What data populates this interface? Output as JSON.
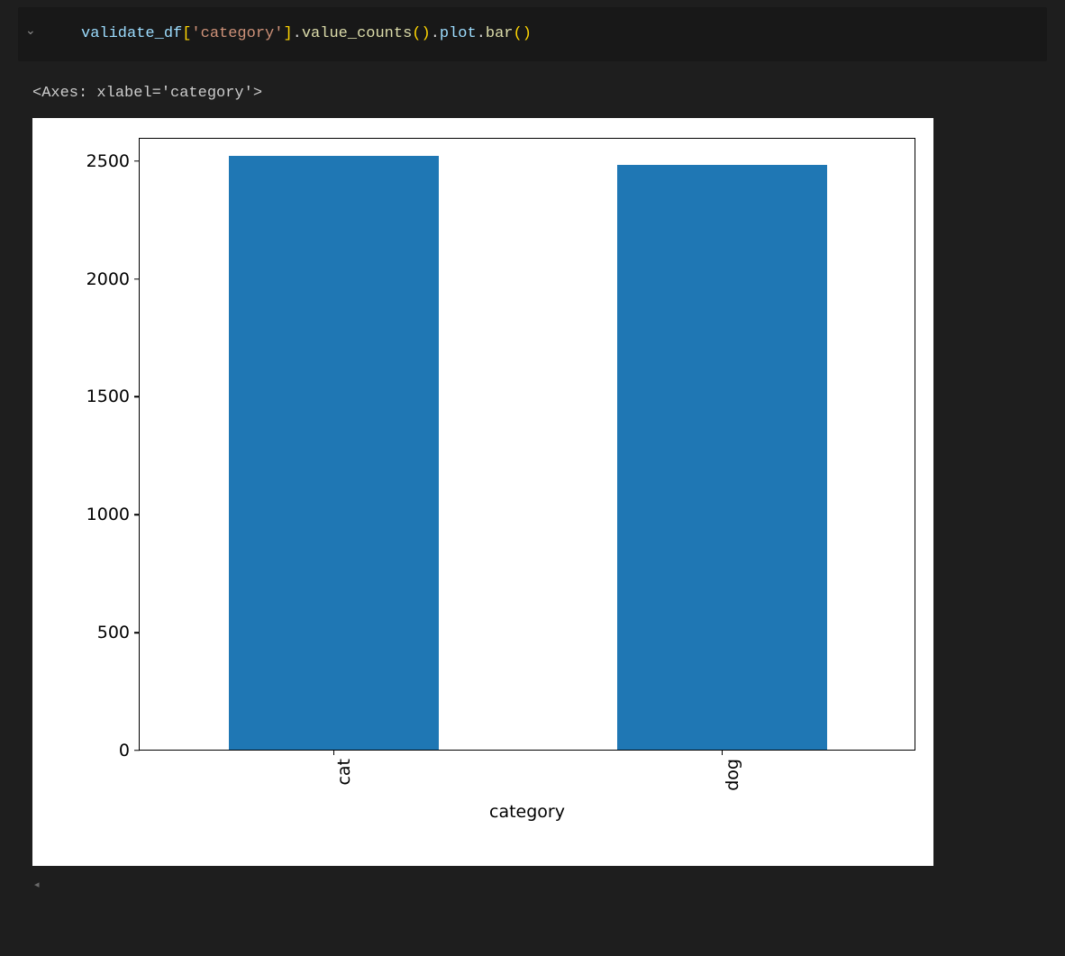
{
  "code": {
    "tokens": [
      {
        "t": "validate_df",
        "c": "tok-var"
      },
      {
        "t": "[",
        "c": "tok-brk"
      },
      {
        "t": "'category'",
        "c": "tok-str"
      },
      {
        "t": "]",
        "c": "tok-brk"
      },
      {
        "t": ".",
        "c": "tok-pun"
      },
      {
        "t": "value_counts",
        "c": "tok-fn"
      },
      {
        "t": "()",
        "c": "tok-brk"
      },
      {
        "t": ".",
        "c": "tok-pun"
      },
      {
        "t": "plot",
        "c": "tok-var"
      },
      {
        "t": ".",
        "c": "tok-pun"
      },
      {
        "t": "bar",
        "c": "tok-fn"
      },
      {
        "t": "()",
        "c": "tok-brk"
      }
    ]
  },
  "output_repr": "<Axes: xlabel='category'>",
  "chart_data": {
    "type": "bar",
    "categories": [
      "cat",
      "dog"
    ],
    "values": [
      2520,
      2480
    ],
    "title": "",
    "xlabel": "category",
    "ylabel": "",
    "ylim": [
      0,
      2600
    ],
    "yticks": [
      0,
      500,
      1000,
      1500,
      2000,
      2500
    ],
    "bar_color": "#1f77b4"
  }
}
